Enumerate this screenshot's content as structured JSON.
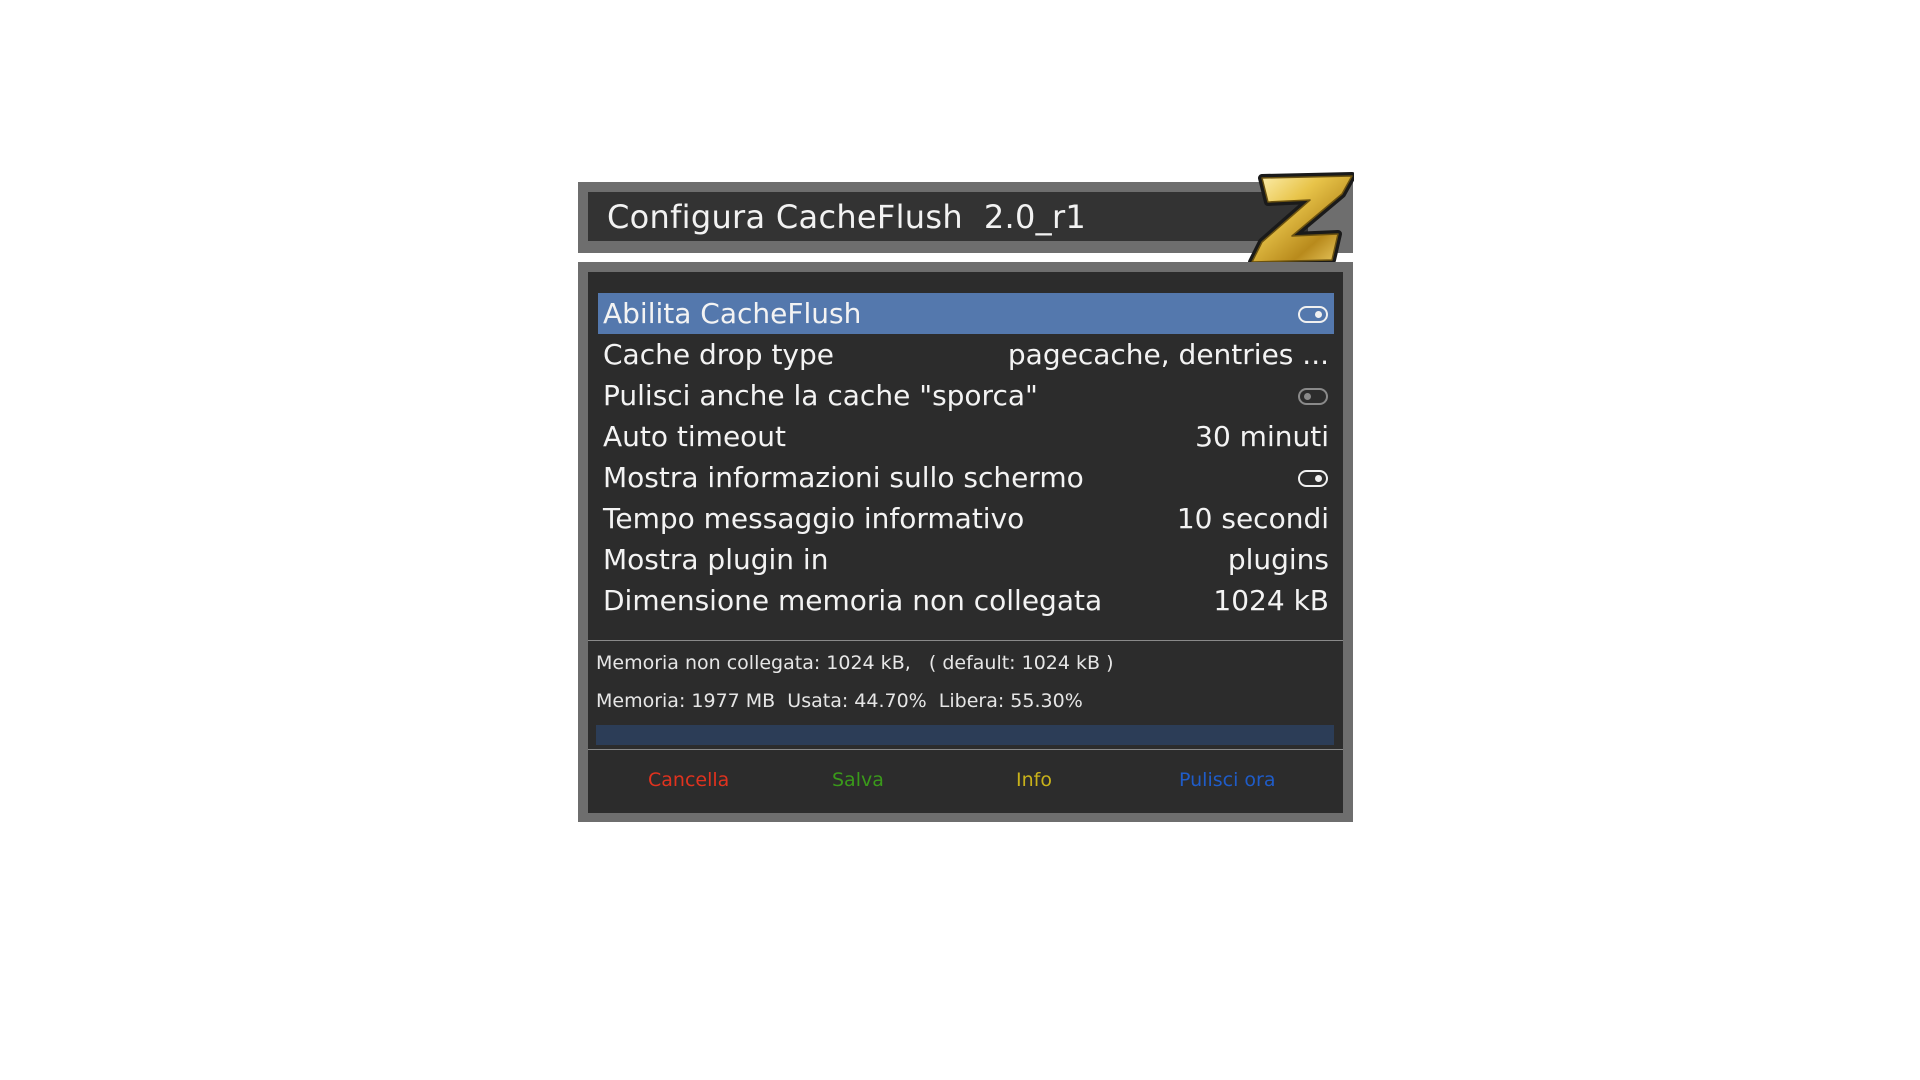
{
  "window": {
    "title": "Configura CacheFlush  2.0_r1",
    "logo_icon": "z-logo-icon"
  },
  "settings": [
    {
      "label": "Abilita CacheFlush",
      "type": "toggle",
      "state": "on",
      "selected": true
    },
    {
      "label": "Cache drop type",
      "type": "value",
      "value": "pagecache, dentries  ..."
    },
    {
      "label": "Pulisci anche la cache \"sporca\"",
      "type": "toggle",
      "state": "off"
    },
    {
      "label": "Auto timeout",
      "type": "value",
      "value": "30 minuti"
    },
    {
      "label": "Mostra informazioni sullo schermo",
      "type": "toggle",
      "state": "on"
    },
    {
      "label": "Tempo messaggio informativo",
      "type": "value",
      "value": "10 secondi"
    },
    {
      "label": "Mostra plugin in",
      "type": "value",
      "value": "plugins"
    },
    {
      "label": "Dimensione memoria non collegata",
      "type": "value",
      "value": "1024 kB"
    }
  ],
  "info": {
    "line1": "Memoria non collegata: 1024 kB,   ( default: 1024 kB )",
    "line2": "Memoria: 1977 MB  Usata: 44.70%  Libera: 55.30%",
    "progress_fraction": 1.0
  },
  "buttons": {
    "red": "Cancella",
    "green": "Salva",
    "yellow": "Info",
    "blue": "Pulisci ora"
  },
  "colors": {
    "selection": "#5478ad",
    "red": "#e0321e",
    "green": "#3a9a1a",
    "yellow": "#c9b21a",
    "blue": "#1f5cc8"
  }
}
